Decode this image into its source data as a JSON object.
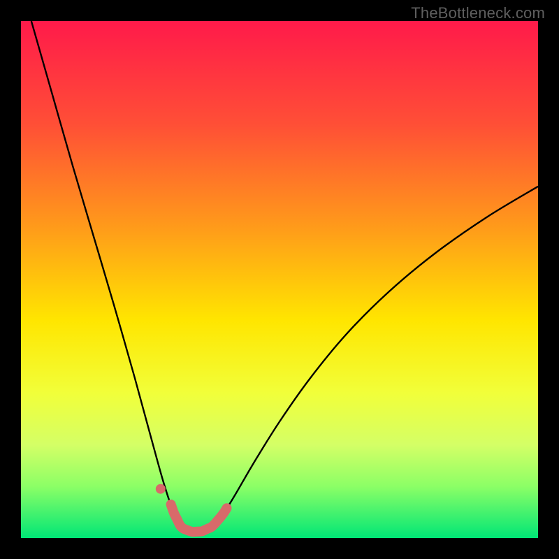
{
  "watermark": {
    "text": "TheBottleneck.com"
  },
  "chart_data": {
    "type": "line",
    "title": "",
    "xlabel": "",
    "ylabel": "",
    "xlim": [
      0,
      100
    ],
    "ylim": [
      0,
      100
    ],
    "grid": false,
    "legend": null,
    "gradient_stops": [
      {
        "offset": 0.0,
        "color": "#ff1a4a"
      },
      {
        "offset": 0.2,
        "color": "#ff4f36"
      },
      {
        "offset": 0.4,
        "color": "#ff9b1a"
      },
      {
        "offset": 0.58,
        "color": "#ffe600"
      },
      {
        "offset": 0.72,
        "color": "#f1ff3a"
      },
      {
        "offset": 0.82,
        "color": "#d4ff66"
      },
      {
        "offset": 0.9,
        "color": "#8cff66"
      },
      {
        "offset": 1.0,
        "color": "#00e676"
      }
    ],
    "curve": {
      "comment": "Bottleneck-percentage style curve; x is normalized position, y is percent (100=top, 0=bottom). Minimum near x≈33.",
      "points": [
        {
          "x": 2.0,
          "y": 100.0
        },
        {
          "x": 6.0,
          "y": 86.0
        },
        {
          "x": 10.0,
          "y": 72.0
        },
        {
          "x": 14.0,
          "y": 58.5
        },
        {
          "x": 18.0,
          "y": 45.0
        },
        {
          "x": 22.0,
          "y": 31.0
        },
        {
          "x": 25.0,
          "y": 20.0
        },
        {
          "x": 27.5,
          "y": 11.0
        },
        {
          "x": 29.5,
          "y": 5.0
        },
        {
          "x": 31.0,
          "y": 2.0
        },
        {
          "x": 33.0,
          "y": 1.2
        },
        {
          "x": 35.0,
          "y": 1.3
        },
        {
          "x": 37.0,
          "y": 2.2
        },
        {
          "x": 39.0,
          "y": 4.5
        },
        {
          "x": 41.5,
          "y": 8.5
        },
        {
          "x": 45.0,
          "y": 14.5
        },
        {
          "x": 50.0,
          "y": 22.5
        },
        {
          "x": 56.0,
          "y": 31.0
        },
        {
          "x": 63.0,
          "y": 39.5
        },
        {
          "x": 71.0,
          "y": 47.5
        },
        {
          "x": 80.0,
          "y": 55.0
        },
        {
          "x": 90.0,
          "y": 62.0
        },
        {
          "x": 100.0,
          "y": 68.0
        }
      ]
    },
    "highlight": {
      "color": "#d86a6a",
      "stroke_width": 14,
      "dot": {
        "x": 27.0,
        "y": 9.5,
        "r": 7
      },
      "segment_x_range": [
        29.0,
        40.0
      ]
    }
  }
}
